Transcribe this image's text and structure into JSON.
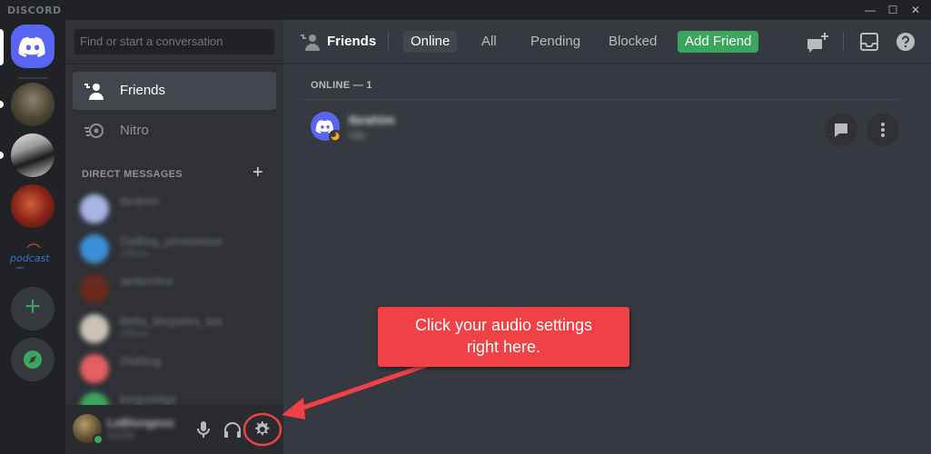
{
  "window": {
    "brand": "DISCORD",
    "minimize_label": "—",
    "maximize_label": "☐",
    "close_label": "✕"
  },
  "servers": [
    {
      "name": "home",
      "icon": "discord-logo-icon"
    },
    {
      "name": "server-1",
      "icon": "server-avatar"
    },
    {
      "name": "server-2",
      "icon": "server-avatar"
    },
    {
      "name": "server-3",
      "icon": "server-avatar"
    },
    {
      "name": "podcast",
      "label": "podcast"
    }
  ],
  "rail": {
    "add_server_label": "+",
    "explore_icon": "compass-icon"
  },
  "sidebar": {
    "search_placeholder": "Find or start a conversation",
    "nav": [
      {
        "label": "Friends",
        "icon": "friends-icon",
        "active": true
      },
      {
        "label": "Nitro",
        "icon": "nitro-icon",
        "active": false
      }
    ],
    "dm_header": "DIRECT MESSAGES",
    "dm_add_label": "+",
    "dms": [
      {
        "name": "Ibrahim",
        "sub": "",
        "color": "#a6b4e6"
      },
      {
        "name": "DaBlog_photowave",
        "sub": "Offline",
        "color": "#3b8fd6"
      },
      {
        "name": "lanternlive",
        "sub": "",
        "color": "#6a2a1c"
      },
      {
        "name": "Bella_blogsites_tea",
        "sub": "Offline",
        "color": "#c9c2b5"
      },
      {
        "name": "DisBlog",
        "sub": "",
        "color": "#e26060"
      },
      {
        "name": "kingvoidge",
        "sub": "",
        "color": "#3ba55d"
      }
    ]
  },
  "user": {
    "name": "LeBlongess",
    "tag": "#1234",
    "mic_icon": "microphone-icon",
    "headset_icon": "headphones-icon",
    "settings_icon": "gear-icon"
  },
  "topbar": {
    "title": "Friends",
    "tabs": [
      "Online",
      "All",
      "Pending",
      "Blocked"
    ],
    "add_friend_label": "Add Friend"
  },
  "friends": {
    "online_header": "ONLINE — 1",
    "list": [
      {
        "name": "Ibrahim",
        "status": "Idle"
      }
    ]
  },
  "annotation": {
    "text_line1": "Click your audio settings",
    "text_line2": "right here.",
    "color": "#ef4146"
  }
}
